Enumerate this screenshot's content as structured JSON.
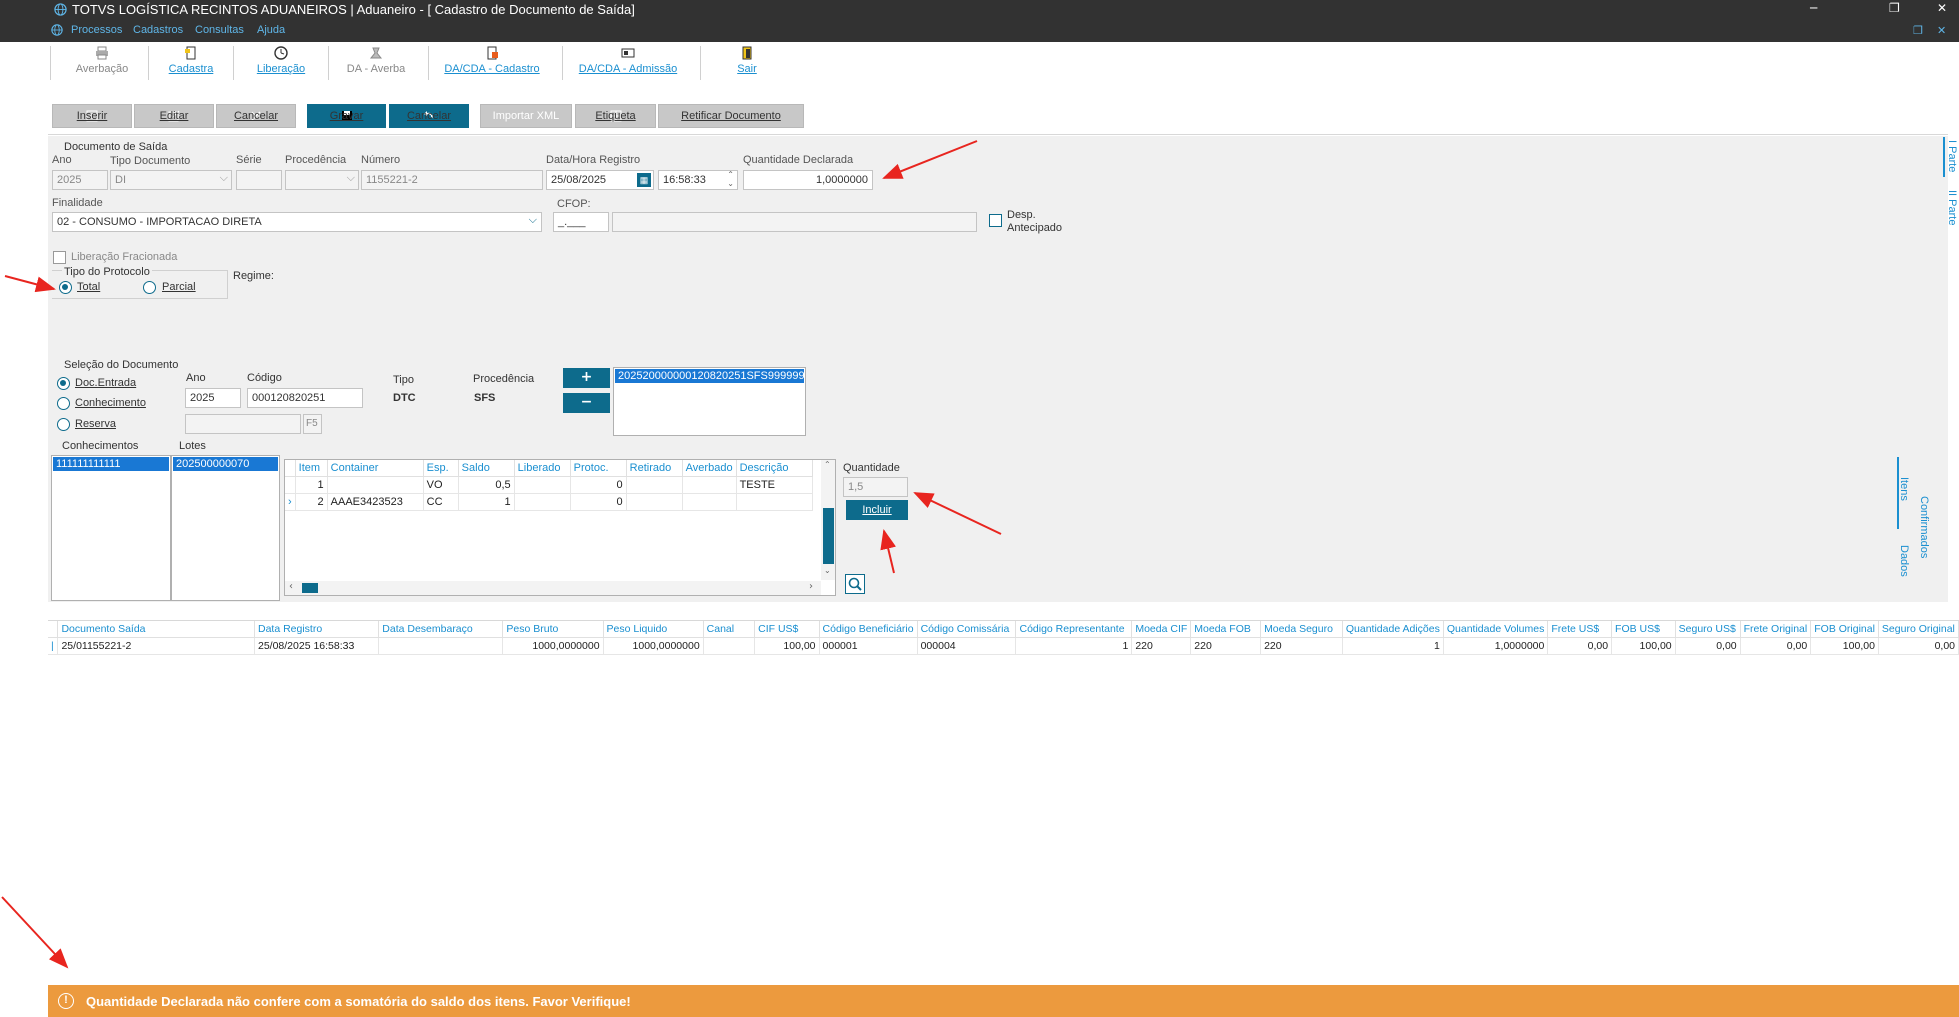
{
  "window": {
    "title": "TOTVS LOGÍSTICA RECINTOS ADUANEIROS | Aduaneiro - [ Cadastro de Documento de Saída]",
    "controls": {
      "minimize": "─",
      "restore": "❐",
      "close": "✕"
    }
  },
  "menu": {
    "items": [
      "Processos",
      "Cadastros",
      "Consultas",
      "Ajuda"
    ]
  },
  "toolbar": {
    "averbacao": "Averbação",
    "cadastra": "Cadastra",
    "liberacao": "Liberação",
    "da_averba": "DA - Averba",
    "da_cda_cadastro": "DA/CDA - Cadastro",
    "da_cda_admissao": "DA/CDA - Admissão",
    "sair": "Sair"
  },
  "actions": {
    "inserir": "Inserir",
    "editar": "Editar",
    "cancelar_disabled": "Cancelar",
    "gravar": "Gravar",
    "cancelar": "Cancelar",
    "importar_xml": "Importar XML",
    "etiqueta": "Etiqueta",
    "retificar": "Retificar Documento"
  },
  "doc": {
    "group_label": "Documento de Saída",
    "ano_label": "Ano",
    "ano": "2025",
    "tipo_label": "Tipo Documento",
    "tipo": "DI",
    "serie_label": "Série",
    "serie": "",
    "procedencia_label": "Procedência",
    "procedencia": "",
    "numero_label": "Número",
    "numero": "1155221-2",
    "data_label": "Data/Hora Registro",
    "data": "25/08/2025",
    "hora": "16:58:33",
    "qtd_label": "Quantidade Declarada",
    "qtd": "1,0000000",
    "finalidade_label": "Finalidade",
    "finalidade": "02 - CONSUMO - IMPORTACAO DIRETA",
    "cfop_label": "CFOP:",
    "cfop": "_.___",
    "cfop_desc": "",
    "desp_antecipado_1": "Desp.",
    "desp_antecipado_2": "Antecipado",
    "lib_fracionada": "Liberação Fracionada",
    "protocolo_label": "Tipo do Protocolo",
    "protocolo_total": "Total",
    "protocolo_parcial": "Parcial",
    "regime_label": "Regime:"
  },
  "selecao": {
    "label": "Seleção do Documento",
    "doc_entrada": "Doc.Entrada",
    "conhecimento": "Conhecimento",
    "reserva": "Reserva",
    "ano_label": "Ano",
    "ano": "2025",
    "codigo_label": "Código",
    "codigo": "000120820251",
    "f5": "F5",
    "tipo_label": "Tipo",
    "tipo": "DTC",
    "procedencia_label": "Procedência",
    "procedencia": "SFS",
    "selected_doc": "202520000000120820251SFS999999",
    "conhecimentos_label": "Conhecimentos",
    "conhecimento_sel": "111111111111",
    "lotes_label": "Lotes",
    "lote_sel": "202500000070",
    "quantidade_label": "Quantidade",
    "quantidade": "1,5",
    "incluir": "Incluir"
  },
  "items_table": {
    "headers": [
      "Item",
      "Container",
      "Esp.",
      "Saldo",
      "Liberado",
      "Protoc.",
      "Retirado",
      "Averbado",
      "Descrição"
    ],
    "rows": [
      [
        "1",
        "",
        "VO",
        "0,5",
        "",
        "0",
        "",
        "",
        "TESTE"
      ],
      [
        "2",
        "AAAE3423523",
        "CC",
        "1",
        "",
        "0",
        "",
        "",
        ""
      ]
    ]
  },
  "side_tabs": {
    "i_parte": "I Parte",
    "ii_parte": "II Parte",
    "itens": "Itens",
    "dados": "Dados",
    "confirmados": "Confirmados"
  },
  "bottom_table": {
    "headers": [
      "Documento Saída",
      "Data Registro",
      "Data  Desembaraço",
      "Peso Bruto",
      "Peso Liquido",
      "Canal",
      "CIF US$",
      "Código Beneficiário",
      "Código Comissária",
      "Código Representante",
      "Moeda CIF",
      "Moeda FOB",
      "Moeda Seguro",
      "Quantidade Adições",
      "Quantidade Volumes",
      "Frete US$",
      "FOB US$",
      "Seguro US$",
      "Frete Original",
      "FOB Original",
      "Seguro Original"
    ],
    "rows": [
      [
        "25/01155221-2",
        "25/08/2025 16:58:33",
        "",
        "1000,0000000",
        "1000,0000000",
        "",
        "100,00",
        "000001",
        "000004",
        "1",
        "220",
        "220",
        "220",
        "1",
        "1,0000000",
        "0,00",
        "100,00",
        "0,00",
        "0,00",
        "100,00",
        "0,00"
      ]
    ]
  },
  "notification": {
    "icon": "!",
    "text": "Quantidade Declarada não confere com a somatória do saldo dos itens. Favor Verifique!"
  },
  "colors": {
    "accent": "#0d6b8c",
    "link": "#1a8fd0",
    "warning": "#ec9a3e",
    "titlebar": "#323232",
    "selection": "#1978d4"
  }
}
